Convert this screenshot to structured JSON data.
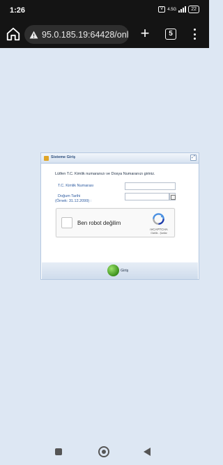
{
  "status_bar": {
    "time": "1:26",
    "network": "4.5G",
    "battery": "22"
  },
  "browser": {
    "url": "95.0.185.19:64428/onli",
    "tab_count": "5",
    "icons": [
      "home-icon",
      "not-secure-warning-icon",
      "new-tab-icon",
      "tab-switcher-icon",
      "menu-icon"
    ]
  },
  "login_panel": {
    "title": "Sisteme Giriş",
    "instructions": "Lütfen T.C. Kimlik numaranızı ve Dosya Numaranızı giriniz.",
    "tc_label": "T.C. Kimlik Numarası",
    "tc_value": "",
    "dob_label": "Doğum Tarihi",
    "dob_example": "(Örnek: 31.12.2099) :",
    "dob_value": "",
    "recaptcha": {
      "checkbox_label": "Ben robot değilim",
      "brand": "reCAPTCHA",
      "links": "Gizlilik - Şartlar"
    },
    "submit_label": "Giriş"
  },
  "colors": {
    "background": "#dde7f3",
    "label_blue": "#2c5aa0",
    "panel_border": "#b5c8e0",
    "submit_green": "#3b8f1c"
  }
}
